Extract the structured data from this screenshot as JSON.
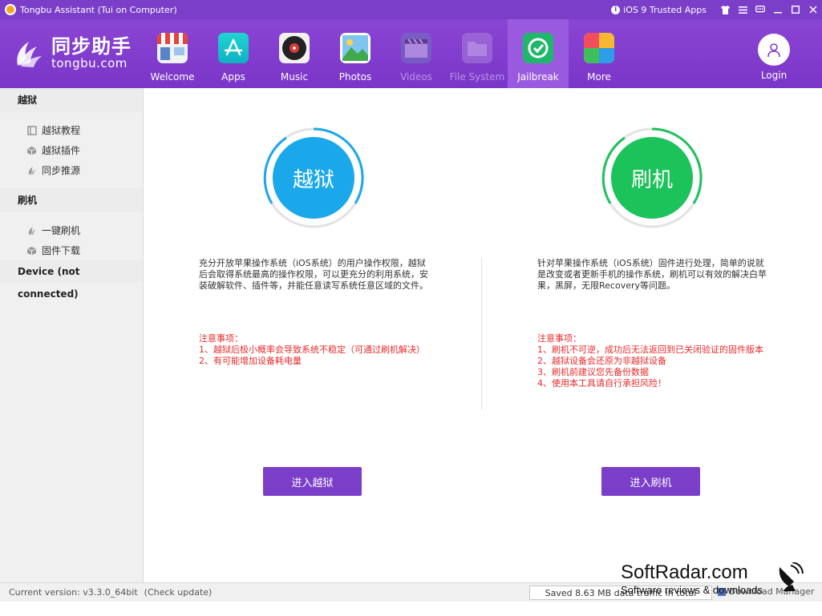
{
  "window": {
    "title": "Tongbu Assistant (Tui on Computer)",
    "trusted_apps": "iOS 9 Trusted Apps",
    "controls": [
      "shirt-icon",
      "menu-icon",
      "chat-icon",
      "minimize-icon",
      "maximize-icon",
      "close-icon"
    ]
  },
  "brand": {
    "name_cn": "同步助手",
    "name_en": "tongbu.com"
  },
  "nav": [
    {
      "label": "Welcome",
      "icon": "store-icon",
      "active": false,
      "enabled": true
    },
    {
      "label": "Apps",
      "icon": "app-store-icon",
      "active": false,
      "enabled": true
    },
    {
      "label": "Music",
      "icon": "music-disc-icon",
      "active": false,
      "enabled": true
    },
    {
      "label": "Photos",
      "icon": "photos-icon",
      "active": false,
      "enabled": true
    },
    {
      "label": "Videos",
      "icon": "clapper-icon",
      "active": false,
      "enabled": false
    },
    {
      "label": "File System",
      "icon": "folder-icon",
      "active": false,
      "enabled": false
    },
    {
      "label": "Jailbreak",
      "icon": "jailbreak-icon",
      "active": true,
      "enabled": true
    },
    {
      "label": "More",
      "icon": "grid-icon",
      "active": false,
      "enabled": true
    }
  ],
  "login": {
    "label": "Login"
  },
  "sidebar": {
    "jailbreak_header": "越狱",
    "jailbreak_items": [
      {
        "label": "越狱教程",
        "icon": "book-icon"
      },
      {
        "label": "越狱插件",
        "icon": "box-icon"
      },
      {
        "label": "同步推源",
        "icon": "feather-icon"
      }
    ],
    "flash_header": "刷机",
    "flash_items": [
      {
        "label": "一键刷机",
        "icon": "feather-icon"
      },
      {
        "label": "固件下载",
        "icon": "box-icon"
      }
    ],
    "device": "Device (not connected)"
  },
  "jailbreak": {
    "title": "越狱",
    "desc": "充分开放苹果操作系统（iOS系统）的用户操作权限，越狱后会取得系统最高的操作权限，可以更充分的利用系统，安装破解软件、插件等，并能任意读写系统任意区域的文件。",
    "notes": [
      "注意事项：",
      "1、越狱后极小概率会导致系统不稳定（可通过刷机解决）",
      "2、有可能增加设备耗电量"
    ],
    "button": "进入越狱"
  },
  "flash": {
    "title": "刷机",
    "desc": "针对苹果操作系统（iOS系统）固件进行处理，简单的说就是改变或者更新手机的操作系统，刷机可以有效的解决白苹果，黑屏，无限Recovery等问题。",
    "notes": [
      "注意事项：",
      "1、刷机不可逆，成功后无法返回到已关闭验证的固件版本",
      "2、越狱设备会还原为非越狱设备",
      "3、刷机前建议您先备份数据",
      "4、使用本工具请自行承担风险！"
    ],
    "button": "进入刷机"
  },
  "status": {
    "version": "Current version: v3.3.0_64bit",
    "check": "(Check update)",
    "saved": "Saved 8.63 MB data traffic in total",
    "download_manager": "Download Manager"
  },
  "watermark": {
    "name": "SoftRadar.com",
    "tagline": "Software reviews & downloads"
  },
  "colors": {
    "brand": "#7b3ec9",
    "jailbreak": "#1aa8ea",
    "flash": "#1cc25a",
    "warning": "#e82a2a"
  }
}
